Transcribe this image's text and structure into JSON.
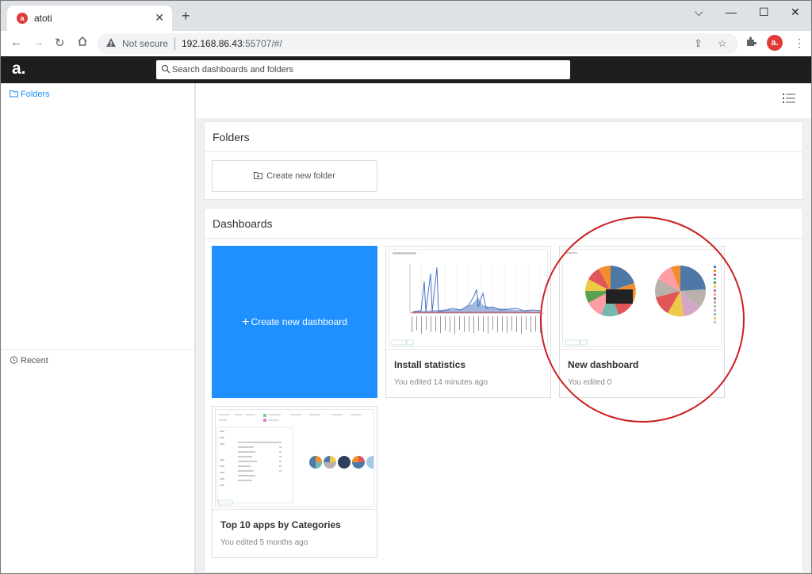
{
  "browser": {
    "tab_title": "atoti",
    "tab_close": "✕",
    "new_tab": "+",
    "not_secure": "Not secure",
    "url_host": "192.168.86.43",
    "url_path": ":55707/#/",
    "profile_letter": "a."
  },
  "app": {
    "logo": "a.",
    "search_placeholder": "Search dashboards and folders",
    "accent_color": "#1e90ff",
    "header_color": "#1e1e1e"
  },
  "sidebar": {
    "folders_label": "Folders",
    "recent_label": "Recent"
  },
  "main": {
    "folders_section": {
      "title": "Folders",
      "create_label": "Create new folder"
    },
    "dashboards_section": {
      "title": "Dashboards",
      "create_label": "Create new dashboard",
      "cards": [
        {
          "title": "Install statistics",
          "subtitle": "You edited 14 minutes ago"
        },
        {
          "title": "New dashboard",
          "subtitle": "You edited 0"
        },
        {
          "title": "Top 10 apps by Categories",
          "subtitle": "You edited 5 months ago"
        }
      ]
    }
  },
  "annotation": {
    "color": "#cc1f1f",
    "shape": "ellipse",
    "target": "New dashboard"
  }
}
